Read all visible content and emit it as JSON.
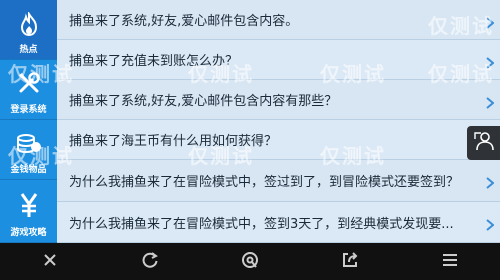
{
  "sidebar": {
    "items": [
      {
        "label": "热点",
        "icon": "flame-icon"
      },
      {
        "label": "登录系统",
        "icon": "tools-icon"
      },
      {
        "label": "金钱物品",
        "icon": "coins-icon"
      },
      {
        "label": "游戏攻略",
        "icon": "yen-icon"
      }
    ]
  },
  "questions": [
    {
      "text": "捕鱼来了系统,好友,爱心邮件包含内容。"
    },
    {
      "text": "捕鱼来了充值未到账怎么办？"
    },
    {
      "text": "捕鱼来了系统,好友,爱心邮件包含内容有那些？"
    },
    {
      "text": "捕鱼来了海王币有什么用如何获得？"
    },
    {
      "text": "为什么我捕鱼来了在冒险模式中，签过到了，到冒险模式还要签到？"
    },
    {
      "text": "为什么我捕鱼来了在冒险模式中，签到3天了，到经典模式发现要..."
    }
  ],
  "watermark": "仅测试",
  "colors": {
    "sidebar": "#1d8fe0",
    "sidebar_active": "#1c6fc4",
    "list_bg": "#dbe8f5",
    "chevron": "#3a8fd8",
    "navbar": "#111111"
  },
  "navbar": {
    "items": [
      "close-icon",
      "refresh-icon",
      "browser-icon",
      "share-icon",
      "menu-icon"
    ]
  }
}
